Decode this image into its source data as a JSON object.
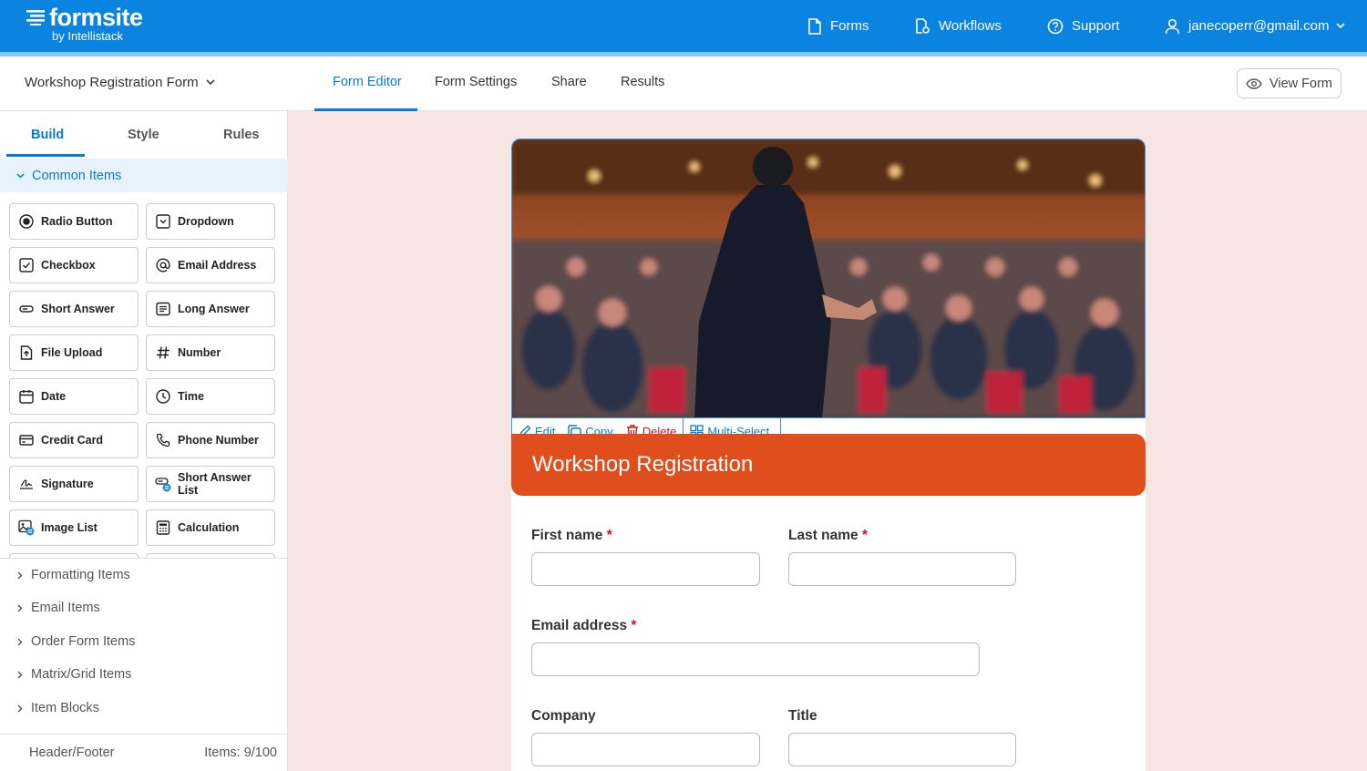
{
  "app": {
    "logo_word": "formsite",
    "logo_sub": "by Intellistack"
  },
  "topnav": {
    "forms": "Forms",
    "workflows": "Workflows",
    "support": "Support",
    "user_email": "janecoperr@gmail.com"
  },
  "subbar": {
    "form_name": "Workshop Registration Form",
    "tabs": [
      "Form Editor",
      "Form Settings",
      "Share",
      "Results"
    ],
    "active_tab": "Form Editor",
    "view_form": "View Form"
  },
  "sidebar": {
    "tabs": [
      "Build",
      "Style",
      "Rules"
    ],
    "active_tab": "Build",
    "section": "Common Items",
    "items": [
      {
        "label": "Radio Button",
        "icon": "radio-icon"
      },
      {
        "label": "Dropdown",
        "icon": "dropdown-icon"
      },
      {
        "label": "Checkbox",
        "icon": "checkbox-icon"
      },
      {
        "label": "Email Address",
        "icon": "at-icon"
      },
      {
        "label": "Short Answer",
        "icon": "short-answer-icon"
      },
      {
        "label": "Long Answer",
        "icon": "long-answer-icon"
      },
      {
        "label": "File Upload",
        "icon": "file-upload-icon"
      },
      {
        "label": "Number",
        "icon": "hash-icon"
      },
      {
        "label": "Date",
        "icon": "calendar-icon"
      },
      {
        "label": "Time",
        "icon": "clock-icon"
      },
      {
        "label": "Credit Card",
        "icon": "credit-card-icon"
      },
      {
        "label": "Phone Number",
        "icon": "phone-icon"
      },
      {
        "label": "Signature",
        "icon": "signature-icon"
      },
      {
        "label": "Short Answer List",
        "icon": "short-answer-list-icon"
      },
      {
        "label": "Image List",
        "icon": "image-list-icon"
      },
      {
        "label": "Calculation",
        "icon": "calculator-icon"
      }
    ],
    "collapsed_sections": [
      "Formatting Items",
      "Email Items",
      "Order Form Items",
      "Matrix/Grid Items",
      "Item Blocks"
    ],
    "footer": {
      "header_footer": "Header/Footer",
      "items_count": "Items: 9/100"
    }
  },
  "form": {
    "toolbar": {
      "edit": "Edit",
      "copy": "Copy",
      "delete": "Delete",
      "multi_select": "Multi-Select"
    },
    "title": "Workshop Registration",
    "fields": {
      "first_name": "First name",
      "last_name": "Last name",
      "email": "Email address",
      "company": "Company",
      "title": "Title"
    },
    "required_mark": "*"
  },
  "colors": {
    "brand_blue": "#0a84e0",
    "accent": "#0a7bd4",
    "banner": "#e04e1e",
    "canvas_bg": "#f7e5e3",
    "delete_red": "#d4161f"
  }
}
